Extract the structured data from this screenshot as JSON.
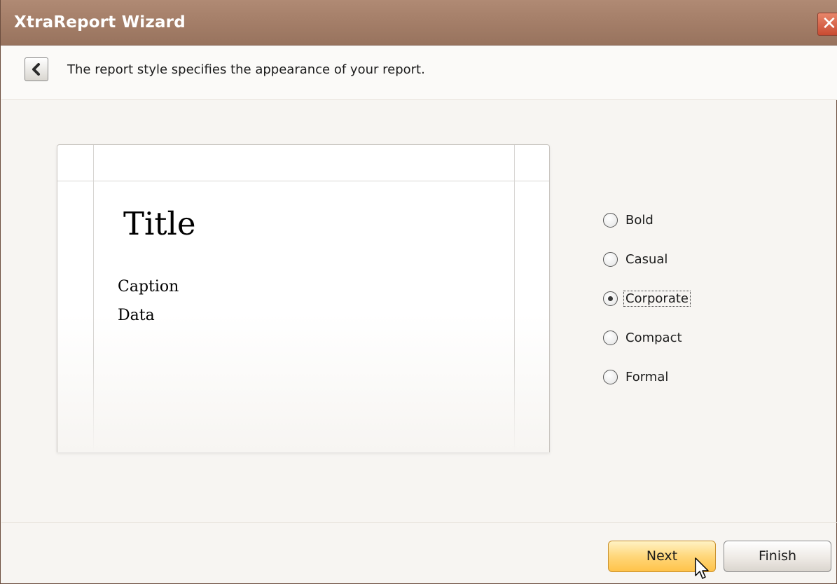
{
  "window": {
    "title": "XtraReport Wizard",
    "close_glyph": "✕"
  },
  "header": {
    "back_icon": "chevron-left-icon",
    "description": "The report style specifies the appearance of your report."
  },
  "preview": {
    "title": "Title",
    "caption": "Caption",
    "data": "Data"
  },
  "styles": {
    "selected": "Corporate",
    "options": [
      {
        "label": "Bold",
        "checked": false
      },
      {
        "label": "Casual",
        "checked": false
      },
      {
        "label": "Corporate",
        "checked": true
      },
      {
        "label": "Compact",
        "checked": false
      },
      {
        "label": "Formal",
        "checked": false
      }
    ]
  },
  "footer": {
    "next_label": "Next",
    "finish_label": "Finish"
  },
  "colors": {
    "titlebar": "#a57f69",
    "next_button": "#ffd77a",
    "close_button": "#c94b32"
  }
}
